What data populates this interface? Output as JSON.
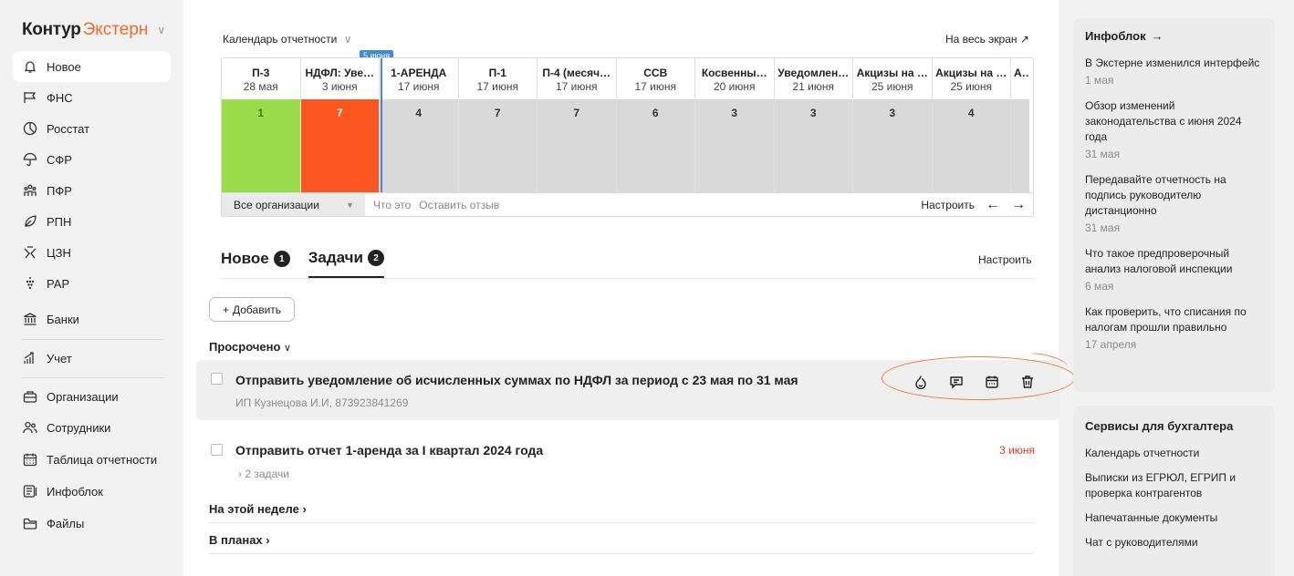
{
  "brand": {
    "part1": "Контур",
    "part2": "Экстерн"
  },
  "sidebar": {
    "items": [
      {
        "label": "Новое",
        "icon": "bell-icon"
      },
      {
        "label": "ФНС",
        "icon": "flag-icon"
      },
      {
        "label": "Росстат",
        "icon": "pie-chart-icon"
      },
      {
        "label": "СФР",
        "icon": "umbrella-icon"
      },
      {
        "label": "ПФР",
        "icon": "people-icon"
      },
      {
        "label": "РПН",
        "icon": "leaf-icon"
      },
      {
        "label": "ЦЗН",
        "icon": "tools-icon"
      },
      {
        "label": "РАР",
        "icon": "grapes-icon"
      },
      {
        "label": "Банки",
        "icon": "bank-icon"
      },
      {
        "label": "Учет",
        "icon": "growth-chart-icon"
      },
      {
        "label": "Организации",
        "icon": "building-icon"
      },
      {
        "label": "Сотрудники",
        "icon": "employees-icon"
      },
      {
        "label": "Таблица отчетности",
        "icon": "calendar-icon"
      },
      {
        "label": "Инфоблок",
        "icon": "infoblock-icon"
      },
      {
        "label": "Файлы",
        "icon": "folder-icon"
      }
    ]
  },
  "calendar": {
    "title": "Календарь отчетности",
    "fullscreen": "На весь экран",
    "today_tag": "5 июня",
    "columns": [
      {
        "title": "П-3",
        "date": "28 мая",
        "count": "1",
        "status": "done"
      },
      {
        "title": "НДФЛ: Уве…",
        "date": "3 июня",
        "count": "7",
        "status": "overdue"
      },
      {
        "title": "1-АРЕНДА",
        "date": "17 июня",
        "count": "4",
        "status": "upcoming"
      },
      {
        "title": "П-1",
        "date": "17 июня",
        "count": "7",
        "status": "upcoming"
      },
      {
        "title": "П-4 (месяч…",
        "date": "17 июня",
        "count": "7",
        "status": "upcoming"
      },
      {
        "title": "ССВ",
        "date": "17 июня",
        "count": "6",
        "status": "upcoming"
      },
      {
        "title": "Косвенны…",
        "date": "20 июня",
        "count": "3",
        "status": "upcoming"
      },
      {
        "title": "Уведомлен…",
        "date": "21 июня",
        "count": "3",
        "status": "upcoming"
      },
      {
        "title": "Акцизы на …",
        "date": "25 июня",
        "count": "3",
        "status": "upcoming"
      },
      {
        "title": "Акцизы на …",
        "date": "25 июня",
        "count": "4",
        "status": "upcoming"
      },
      {
        "title": "Акі",
        "date": "",
        "count": "",
        "status": "upcoming"
      }
    ],
    "org_select": "Все организации",
    "what_is": "Что это",
    "feedback": "Оставить отзыв",
    "configure": "Настроить"
  },
  "tabs": [
    {
      "label": "Новое",
      "badge": "1"
    },
    {
      "label": "Задачи",
      "badge": "2"
    }
  ],
  "tabs_configure": "Настроить",
  "add_button": "Добавить",
  "sections": {
    "overdue": "Просрочено",
    "this_week": "На этой неделе",
    "planned": "В планах"
  },
  "tasks": [
    {
      "title": "Отправить уведомление об исчисленных суммах по НДФЛ за период с 23 мая по 31 мая",
      "subtitle": "ИП Кузнецова И.И, 873923841269",
      "date": ""
    },
    {
      "title": "Отправить отчет 1-аренда за I квартал 2024 года",
      "subtitle": "2 задачи",
      "date": "3 июня"
    }
  ],
  "infoblock": {
    "title": "Инфоблок",
    "items": [
      {
        "text": "В Экстерне изменился интерфейс",
        "date": "1 мая"
      },
      {
        "text": "Обзор изменений законодательства с июня 2024 года",
        "date": "31 мая"
      },
      {
        "text": "Передавайте отчетность на подпись руководителю дистанционно",
        "date": "31 мая"
      },
      {
        "text": "Что такое предпроверочный анализ налоговой инспекции",
        "date": "6 мая"
      },
      {
        "text": "Как проверить, что списания по налогам прошли правильно",
        "date": "17 апреля"
      }
    ]
  },
  "services": {
    "title": "Сервисы для бухгалтера",
    "items": [
      "Календарь отчетности",
      "Выписки из ЕГРЮЛ, ЕГРИП и проверка контрагентов",
      "Напечатанные документы",
      "Чат с руководителями"
    ]
  },
  "colors": {
    "accent": "#f06b2c",
    "done": "#9bdc4c",
    "overdue": "#fb5520",
    "today": "#3c8bdc",
    "due": "#e03a2c"
  }
}
